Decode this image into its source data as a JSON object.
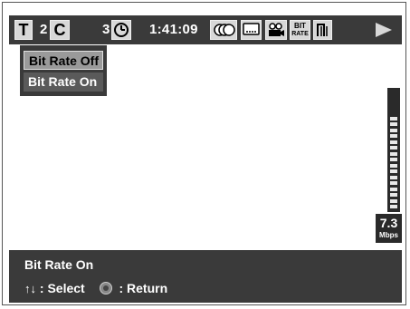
{
  "status_bar": {
    "title_label": "T",
    "chapter_number": "2",
    "chapter_label": "C",
    "track_number": "3",
    "time": "1:41:09",
    "icons": [
      "clock-icon",
      "audio-icon",
      "subtitle-icon",
      "angle-icon",
      "bitrate-icon",
      "repeat-icon",
      "play-icon"
    ],
    "bitrate_icon_text_top": "BIT",
    "bitrate_icon_text_bottom": "RATE"
  },
  "menu": {
    "items": [
      {
        "label": "Bit Rate Off"
      },
      {
        "label": "Bit Rate On"
      }
    ],
    "selected_index": 1
  },
  "meter": {
    "value": "7.3",
    "unit": "Mbps",
    "level_fraction": 0.8
  },
  "info_bar": {
    "status_title": "Bit Rate On",
    "select_hint": ": Select",
    "return_hint": ": Return"
  }
}
